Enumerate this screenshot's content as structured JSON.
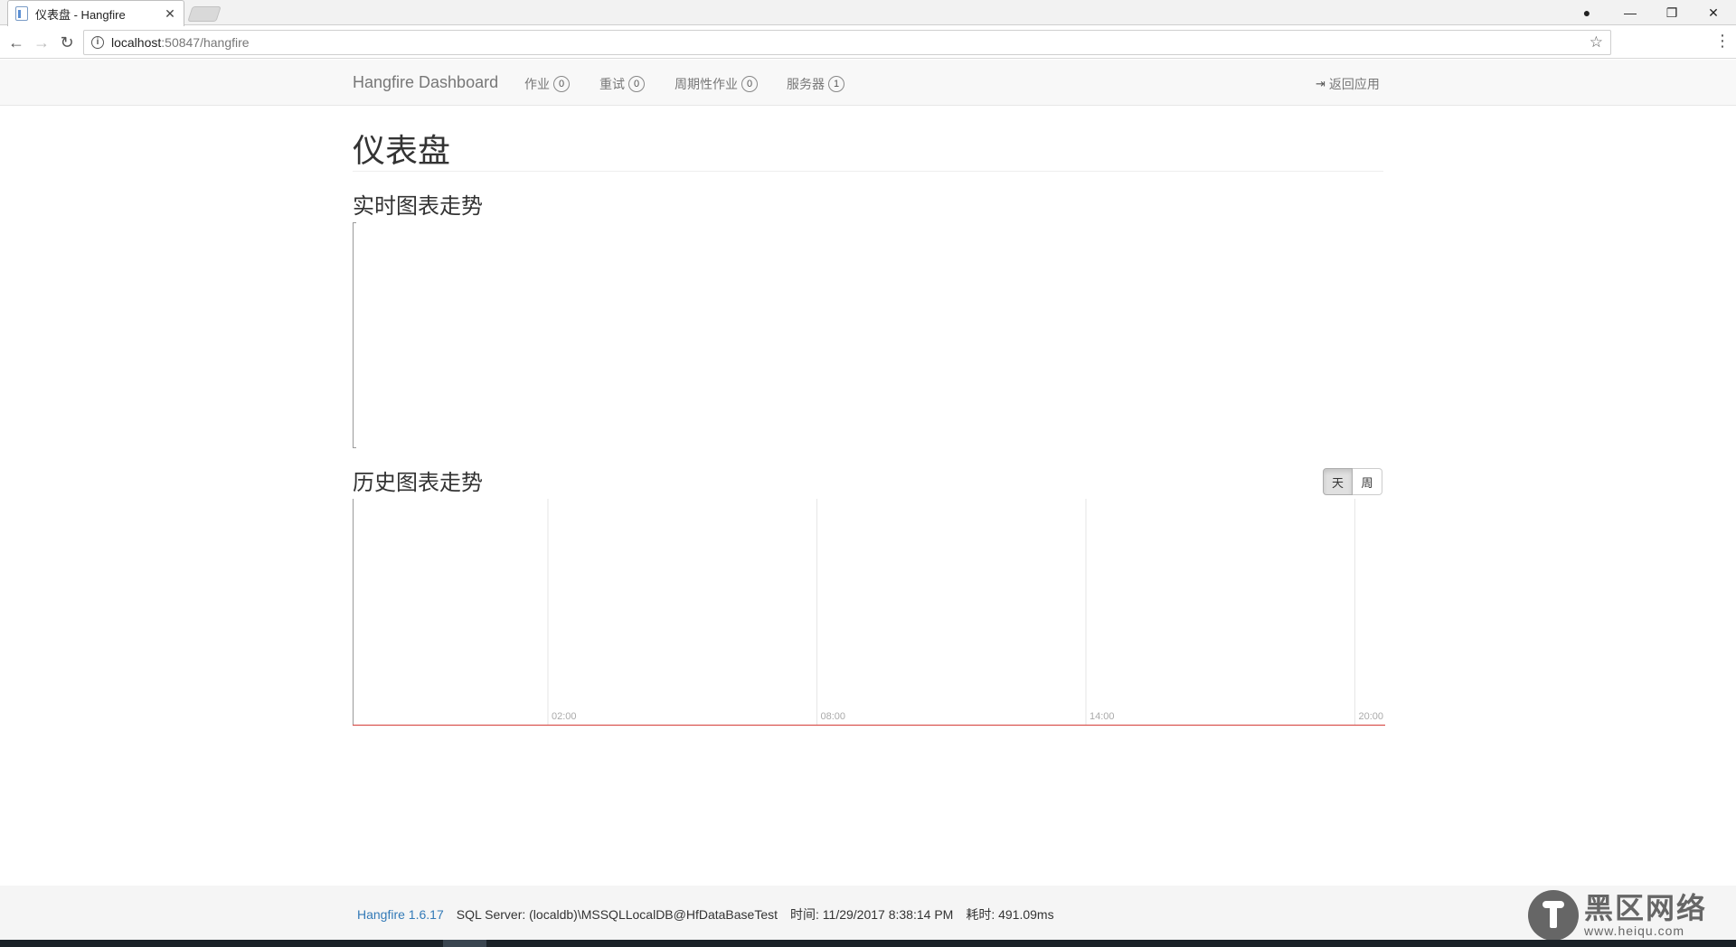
{
  "browser": {
    "tab_title": "仪表盘 - Hangfire",
    "tab_close": "✕",
    "url_host": "localhost",
    "url_path": ":50847/hangfire",
    "back_glyph": "←",
    "forward_glyph": "→",
    "reload_glyph": "↻",
    "star_glyph": "☆",
    "menu_glyph": "⋮",
    "info_glyph": "i",
    "account_glyph": "●",
    "minimize_glyph": "—",
    "restore_glyph": "❐",
    "close_glyph": "✕"
  },
  "nav": {
    "brand": "Hangfire Dashboard",
    "items": [
      {
        "label": "作业",
        "count": "0"
      },
      {
        "label": "重试",
        "count": "0"
      },
      {
        "label": "周期性作业",
        "count": "0"
      },
      {
        "label": "服务器",
        "count": "1"
      }
    ],
    "back_label": "返回应用",
    "back_icon": "exit-icon"
  },
  "page": {
    "title": "仪表盘",
    "realtime_title": "实时图表走势",
    "history_title": "历史图表走势",
    "toggle_day": "天",
    "toggle_week": "周",
    "active_toggle": "天"
  },
  "chart_data": [
    {
      "type": "line",
      "title": "实时图表走势",
      "series": [],
      "x": [],
      "grid": false
    },
    {
      "type": "line",
      "title": "历史图表走势",
      "x_ticks": [
        "02:00",
        "08:00",
        "14:00",
        "20:00"
      ],
      "series": [],
      "grid": true,
      "line_color": "#d9534f"
    }
  ],
  "footer": {
    "version": "Hangfire 1.6.17",
    "storage": "SQL Server: (localdb)\\MSSQLLocalDB@HfDataBaseTest",
    "time": "时间: 11/29/2017 8:38:14 PM",
    "elapsed": "耗时: 491.09ms"
  },
  "watermark": {
    "cn": "黑区网络",
    "url": "www.heiqu.com"
  }
}
